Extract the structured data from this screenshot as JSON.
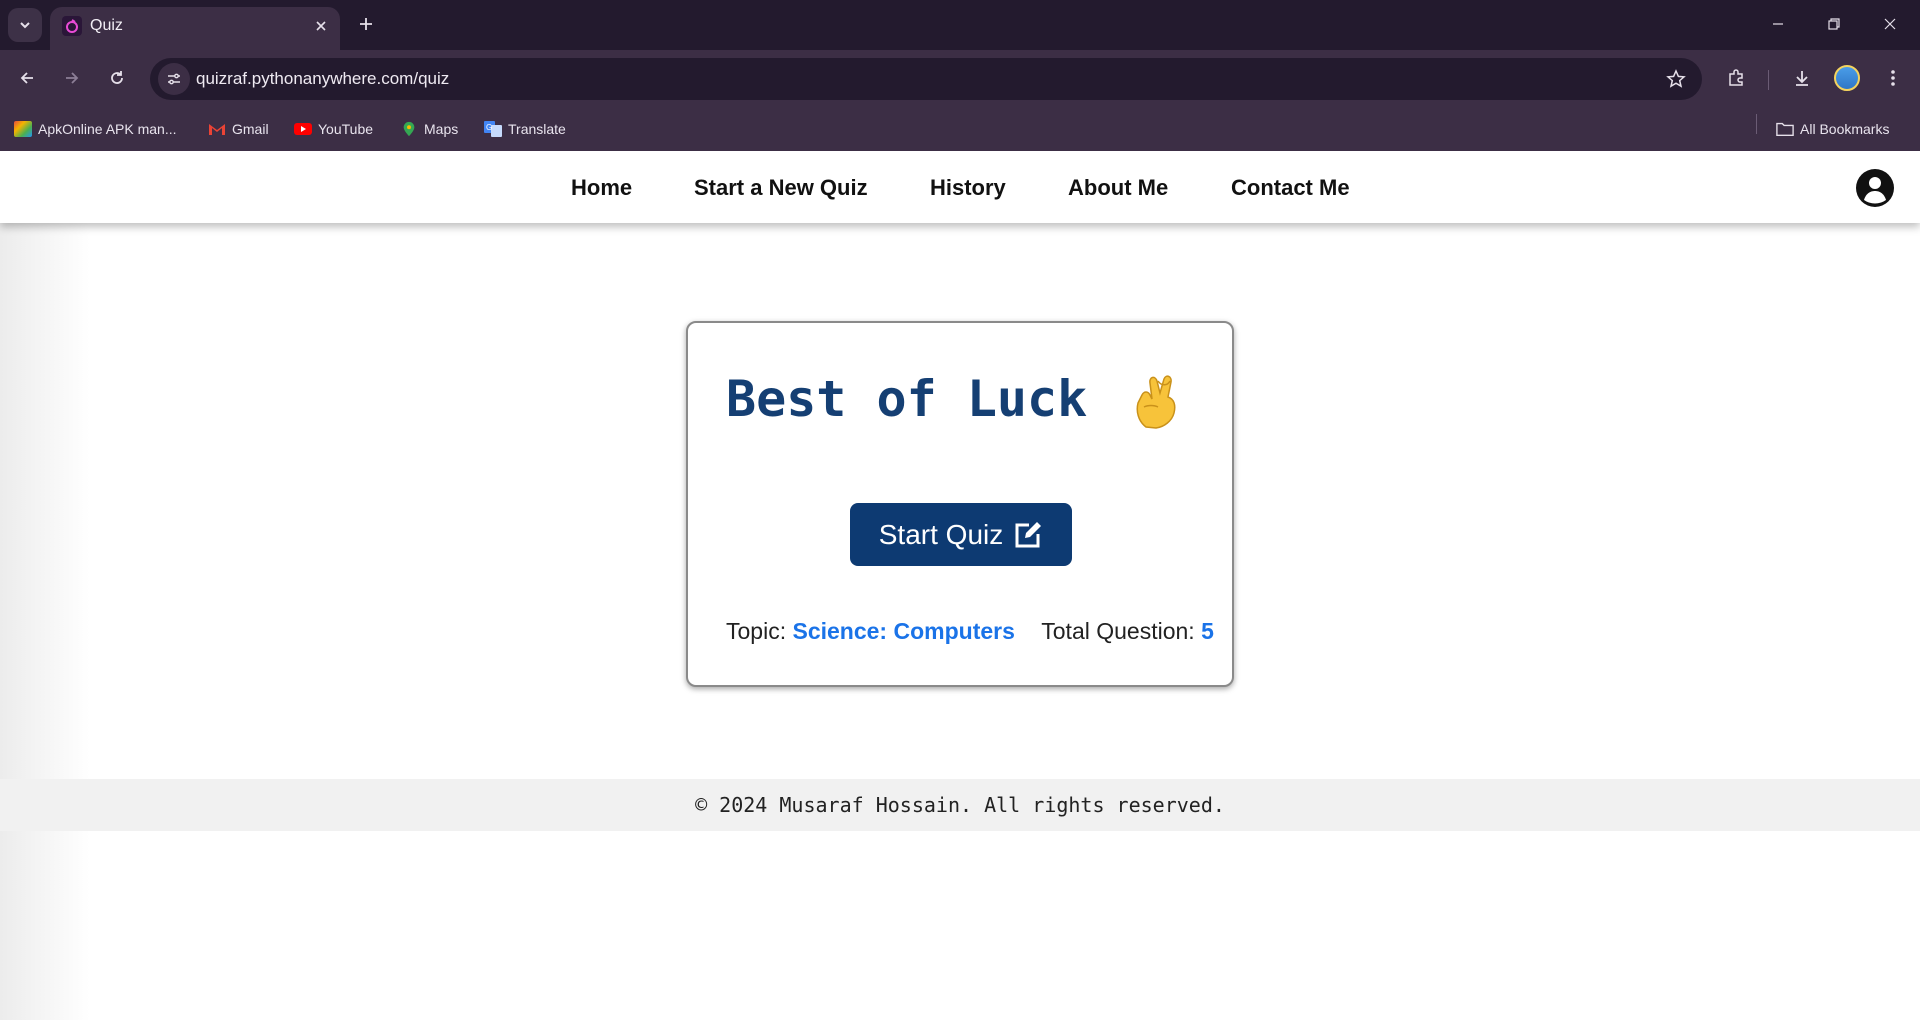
{
  "browser": {
    "tab_title": "Quiz",
    "url": "quizraf.pythonanywhere.com/quiz",
    "bookmarks": [
      {
        "label": "ApkOnline APK man..."
      },
      {
        "label": "Gmail"
      },
      {
        "label": "YouTube"
      },
      {
        "label": "Maps"
      },
      {
        "label": "Translate"
      }
    ],
    "all_bookmarks_label": "All Bookmarks"
  },
  "navbar": {
    "links": [
      {
        "label": "Home"
      },
      {
        "label": "Start a New Quiz"
      },
      {
        "label": "History"
      },
      {
        "label": "About Me"
      },
      {
        "label": "Contact Me"
      }
    ]
  },
  "card": {
    "title": "Best of Luck",
    "emoji_icon": "crossed-fingers-icon",
    "start_button_label": "Start Quiz",
    "start_button_icon": "edit-icon",
    "topic_label": "Topic:",
    "topic_value": "Science: Computers",
    "total_label": "Total Question:",
    "total_value": "5"
  },
  "footer": {
    "text": "© 2024 Musaraf Hossain. All rights reserved."
  },
  "colors": {
    "title": "#153f73",
    "button": "#0d3a72",
    "accent": "#1a73e8",
    "chrome": "#3c2e45"
  }
}
